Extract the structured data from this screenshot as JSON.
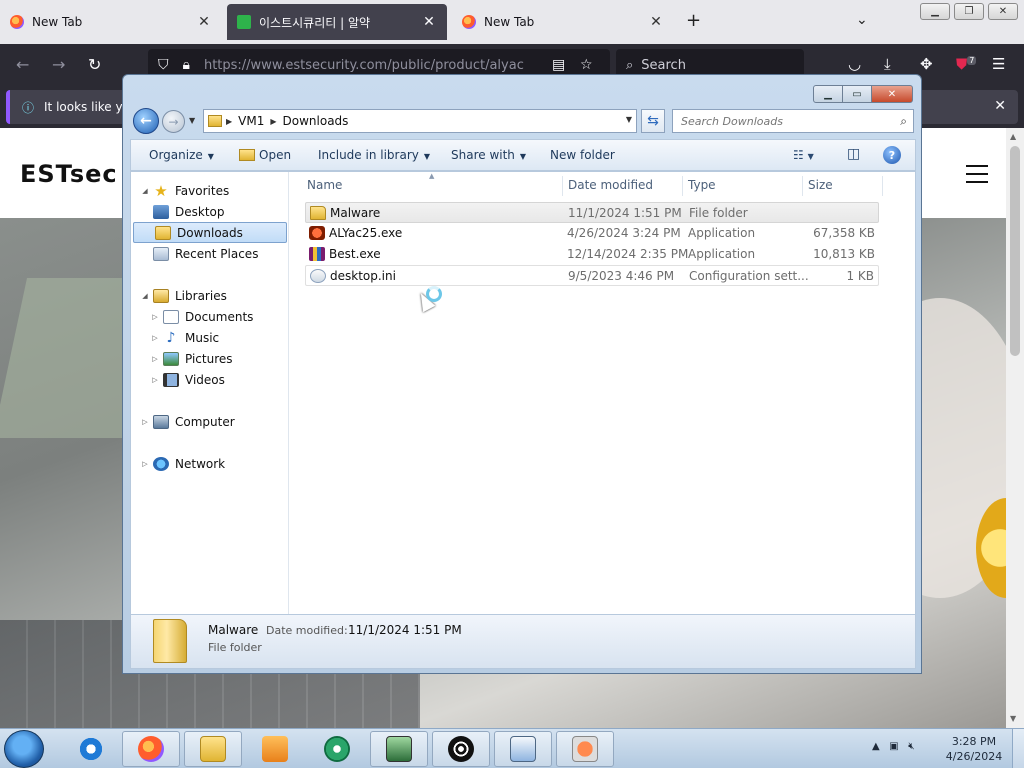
{
  "browser": {
    "tabs": [
      {
        "title": "New Tab"
      },
      {
        "title": "이스트시큐리티 | 알약"
      },
      {
        "title": "New Tab"
      }
    ],
    "url": "https://www.estsecurity.com/public/product/alyac",
    "search_placeholder": "Search",
    "notice_text": "It looks like you",
    "extension_badge": "7"
  },
  "site": {
    "logo": "ESTsec"
  },
  "explorer": {
    "breadcrumb": [
      "VM1",
      "Downloads"
    ],
    "search_placeholder": "Search Downloads",
    "commands": {
      "organize": "Organize",
      "open": "Open",
      "include": "Include in library",
      "share": "Share with",
      "new_folder": "New folder"
    },
    "nav": {
      "favorites": "Favorites",
      "desktop": "Desktop",
      "downloads": "Downloads",
      "recent": "Recent Places",
      "libraries": "Libraries",
      "documents": "Documents",
      "music": "Music",
      "pictures": "Pictures",
      "videos": "Videos",
      "computer": "Computer",
      "network": "Network"
    },
    "columns": {
      "name": "Name",
      "date": "Date modified",
      "type": "Type",
      "size": "Size"
    },
    "files": [
      {
        "name": "Malware",
        "date": "11/1/2024 1:51 PM",
        "type": "File folder",
        "size": "",
        "icon": "folder-icon"
      },
      {
        "name": "ALYac25.exe",
        "date": "4/26/2024 3:24 PM",
        "type": "Application",
        "size": "67,358 KB",
        "icon": "alyac-app-icon"
      },
      {
        "name": "Best.exe",
        "date": "12/14/2024 2:35 PM",
        "type": "Application",
        "size": "10,813 KB",
        "icon": "winrar-app-icon"
      },
      {
        "name": "desktop.ini",
        "date": "9/5/2023 4:46 PM",
        "type": "Configuration sett...",
        "size": "1 KB",
        "icon": "settings-file-icon"
      }
    ],
    "details": {
      "name": "Malware",
      "date_label": "Date modified:",
      "date_value": "11/1/2024 1:51 PM",
      "type": "File folder"
    }
  },
  "taskbar": {
    "time": "3:28 PM",
    "date": "4/26/2024"
  }
}
